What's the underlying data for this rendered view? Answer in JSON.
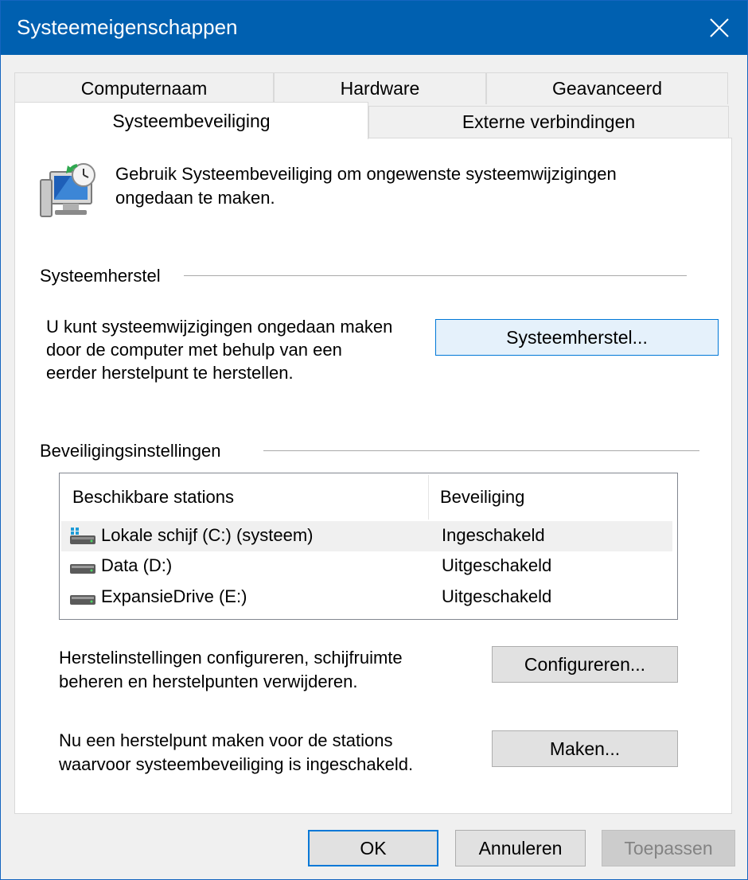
{
  "window": {
    "title": "Systeemeigenschappen"
  },
  "tabs": {
    "row1": [
      "Computernaam",
      "Hardware",
      "Geavanceerd"
    ],
    "row2": [
      "Systeembeveiliging",
      "Externe verbindingen"
    ],
    "active": "Systeembeveiliging"
  },
  "intro": {
    "text_line1": "Gebruik Systeembeveiliging om ongewenste systeemwijzigingen",
    "text_line2": "ongedaan te maken."
  },
  "restore": {
    "group_label": "Systeemherstel",
    "desc_line1": "U kunt systeemwijzigingen ongedaan maken",
    "desc_line2": "door de computer met behulp van een",
    "desc_line3": "eerder herstelpunt te herstellen.",
    "button_label": "Systeemherstel..."
  },
  "protection": {
    "group_label": "Beveiligingsinstellingen",
    "columns": [
      "Beschikbare stations",
      "Beveiliging"
    ],
    "drives": [
      {
        "name": "Lokale schijf (C:) (systeem)",
        "status": "Ingeschakeld",
        "icon": "system-drive-icon"
      },
      {
        "name": "Data (D:)",
        "status": "Uitgeschakeld",
        "icon": "hard-drive-icon"
      },
      {
        "name": "ExpansieDrive (E:)",
        "status": "Uitgeschakeld",
        "icon": "hard-drive-icon"
      }
    ],
    "configure_desc_line1": "Herstelinstellingen configureren, schijfruimte",
    "configure_desc_line2": "beheren en herstelpunten verwijderen.",
    "configure_button": "Configureren...",
    "create_desc_line1": "Nu een herstelpunt maken voor de stations",
    "create_desc_line2": "waarvoor systeembeveiliging is ingeschakeld.",
    "create_button": "Maken..."
  },
  "footer": {
    "ok": "OK",
    "cancel": "Annuleren",
    "apply": "Toepassen"
  },
  "colors": {
    "titlebar": "#0060b0",
    "accent": "#0078d7"
  }
}
